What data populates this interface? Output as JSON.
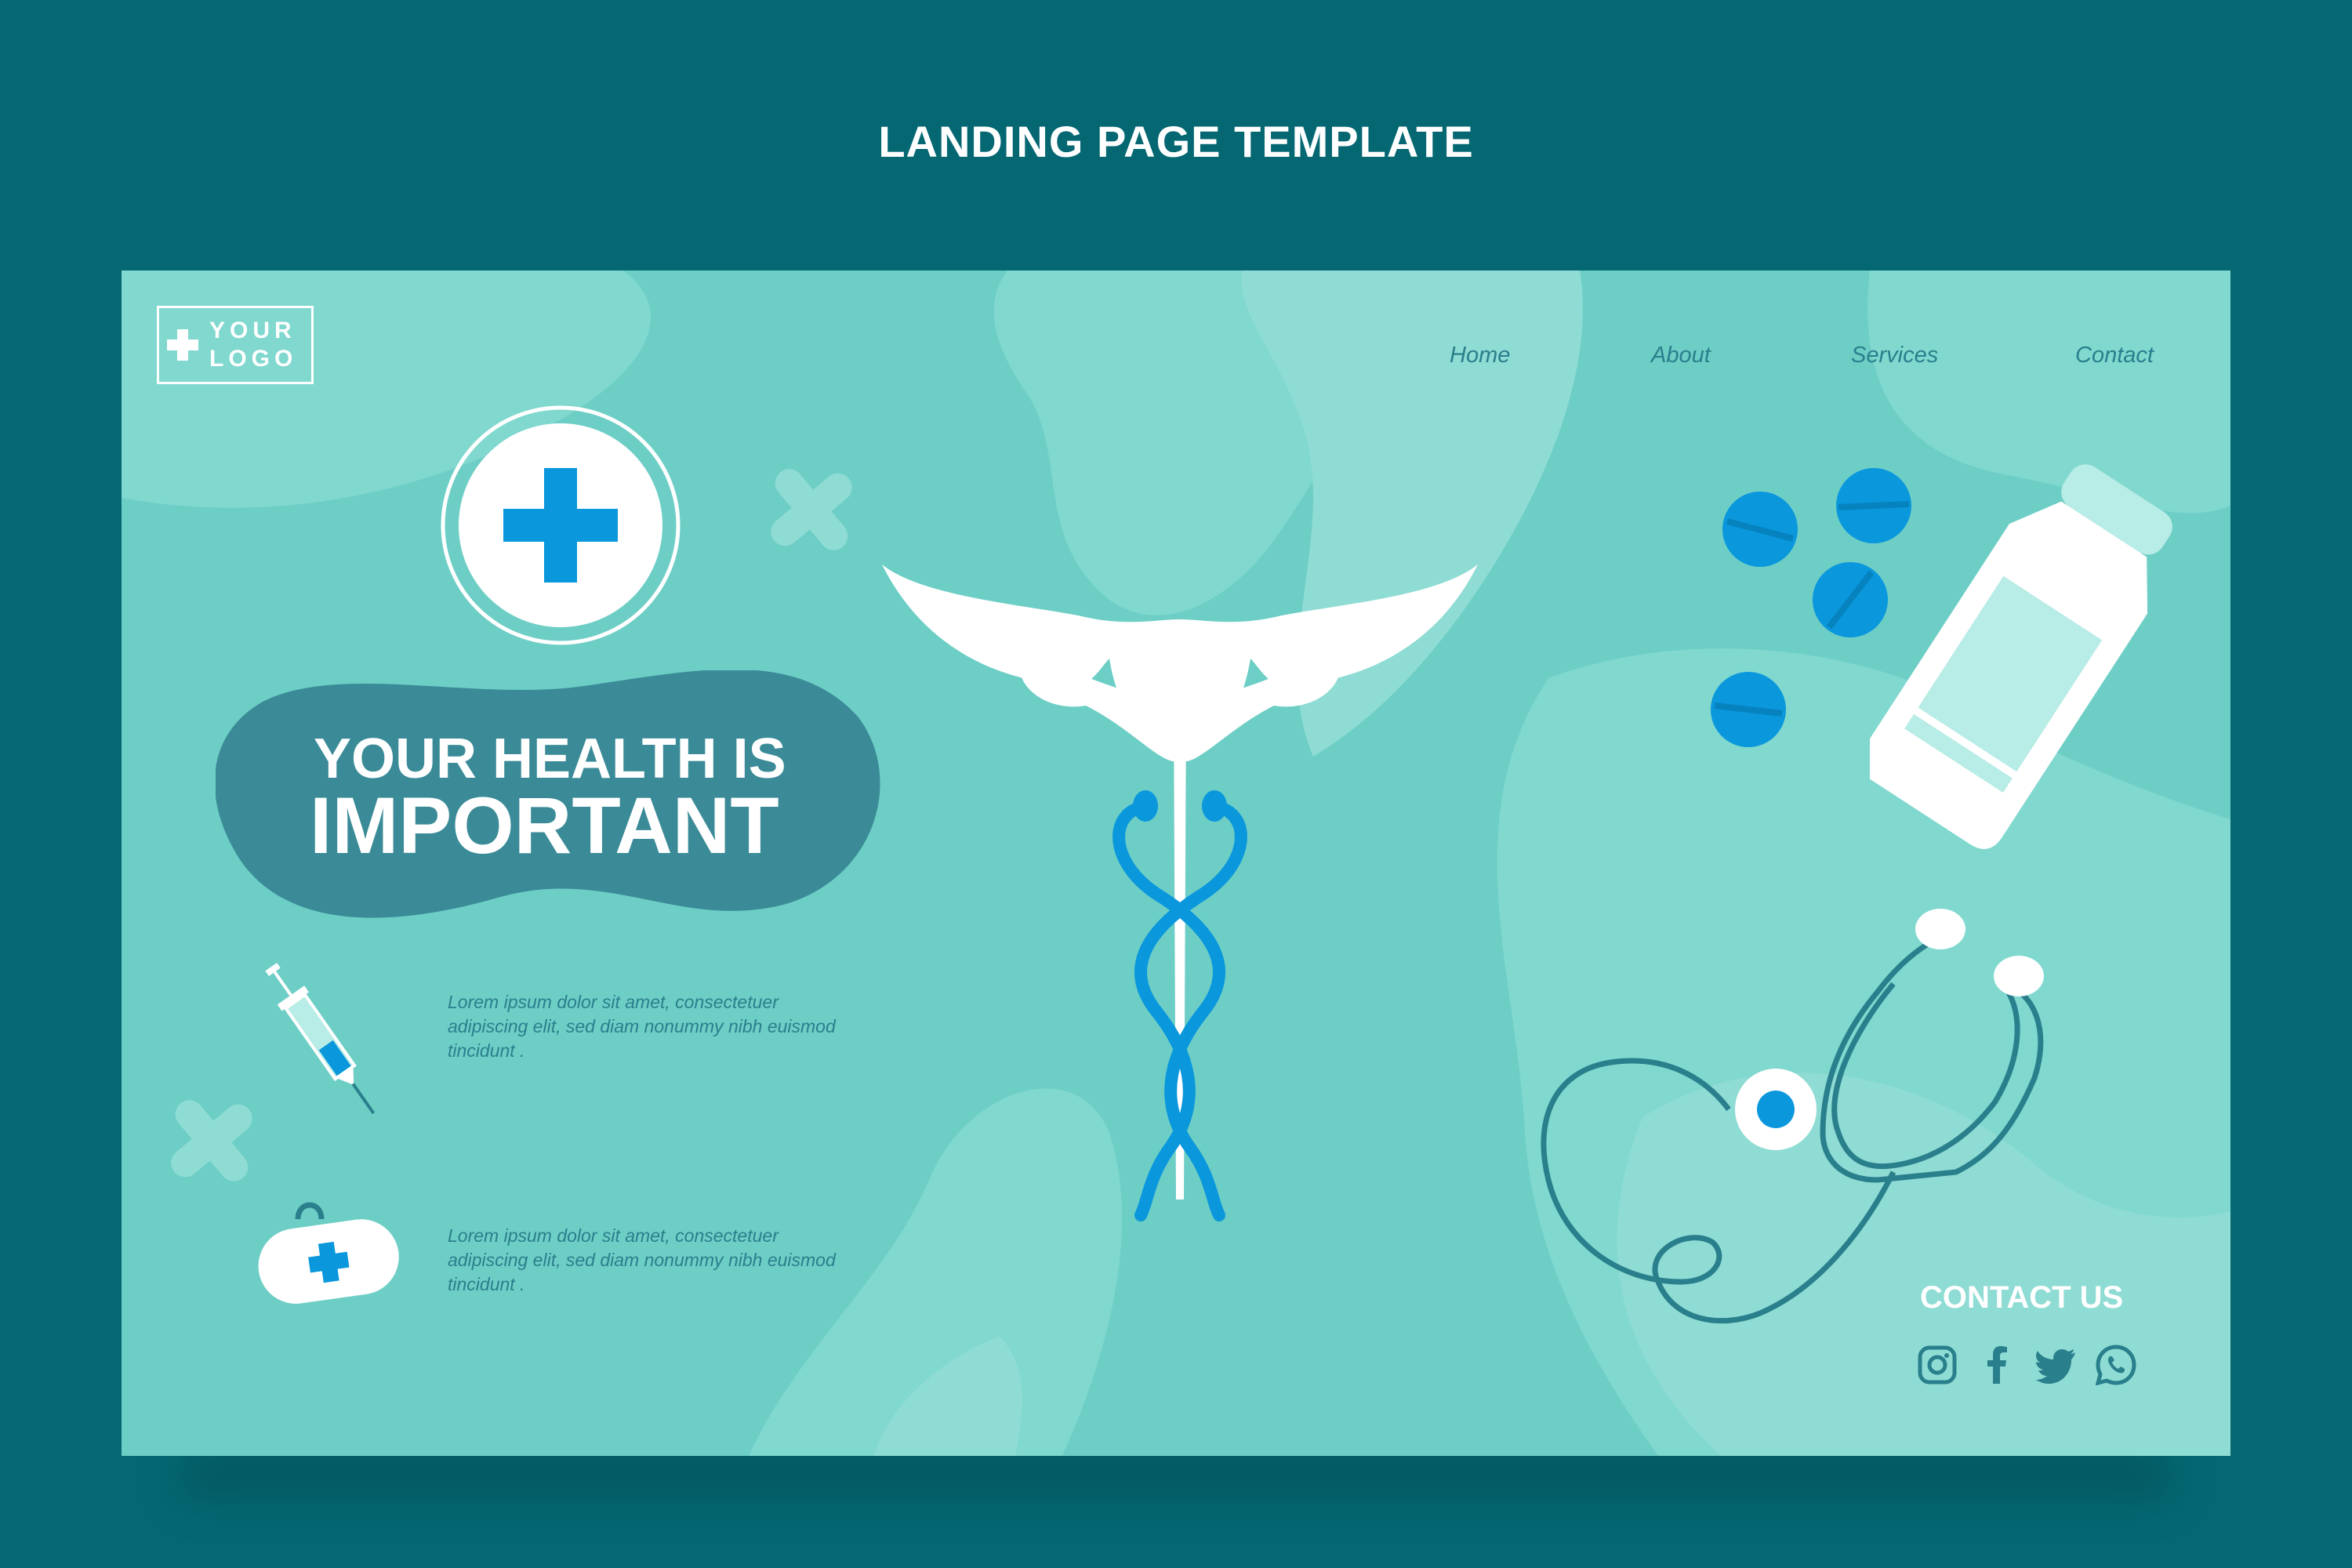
{
  "template_title": "LANDING PAGE TEMPLATE",
  "logo": {
    "line1": "YOUR",
    "line2": "LOGO"
  },
  "nav": {
    "items": [
      {
        "label": "Home"
      },
      {
        "label": "About"
      },
      {
        "label": "Services"
      },
      {
        "label": "Contact"
      }
    ]
  },
  "hero": {
    "line1": "YOUR HEALTH IS",
    "line2": "IMPORTANT"
  },
  "info_blocks": [
    {
      "text": "Lorem ipsum dolor sit amet, consectetuer adipiscing elit, sed diam nonummy nibh euismod tincidunt ."
    },
    {
      "text": "Lorem ipsum dolor sit amet, consectetuer adipiscing elit, sed diam nonummy nibh euismod tincidunt ."
    }
  ],
  "contact": {
    "title": "CONTACT US",
    "socials": [
      "instagram-icon",
      "facebook-icon",
      "twitter-icon",
      "whatsapp-icon"
    ]
  },
  "colors": {
    "background": "#046772",
    "page": "#6dcec6",
    "accent_blue": "#0a97dc",
    "text_teal": "#2a7f8c",
    "hero_blob": "#3a8b97"
  }
}
